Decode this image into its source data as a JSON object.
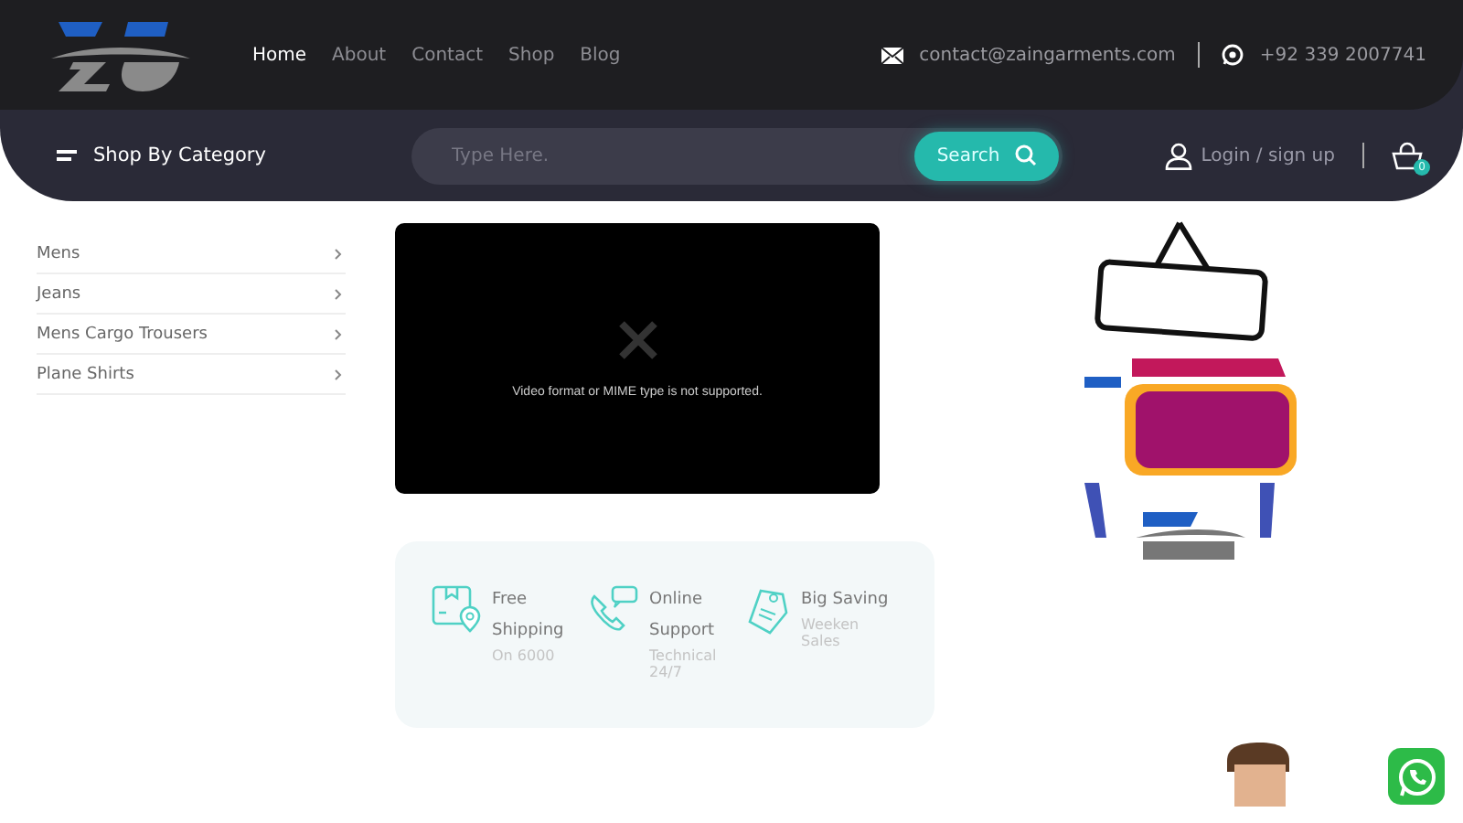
{
  "nav": [
    {
      "label": "Home",
      "selected": true
    },
    {
      "label": "About",
      "selected": false
    },
    {
      "label": "Contact",
      "selected": false
    },
    {
      "label": "Shop",
      "selected": false
    },
    {
      "label": "Blog",
      "selected": false
    }
  ],
  "contact": {
    "email": "contact@zaingarments.com",
    "phone": "+92 339 2007741"
  },
  "category_menu": {
    "label": "Shop By Category"
  },
  "search": {
    "placeholder": "Type Here.",
    "button": "Search"
  },
  "account": {
    "login": "Login / sign up",
    "cart_count": "0"
  },
  "categories": [
    {
      "label": "Mens"
    },
    {
      "label": "Jeans"
    },
    {
      "label": "Mens Cargo Trousers"
    },
    {
      "label": "Plane Shirts"
    }
  ],
  "video": {
    "message": "Video format or MIME type is not supported."
  },
  "features": [
    {
      "kind": "shipping",
      "title": "Free Shipping",
      "note": "On 6000"
    },
    {
      "kind": "support",
      "title": "Online Support",
      "note": "Technical 24/7"
    },
    {
      "kind": "saving",
      "title": "Big Saving",
      "note": "Weeken Sales"
    }
  ]
}
